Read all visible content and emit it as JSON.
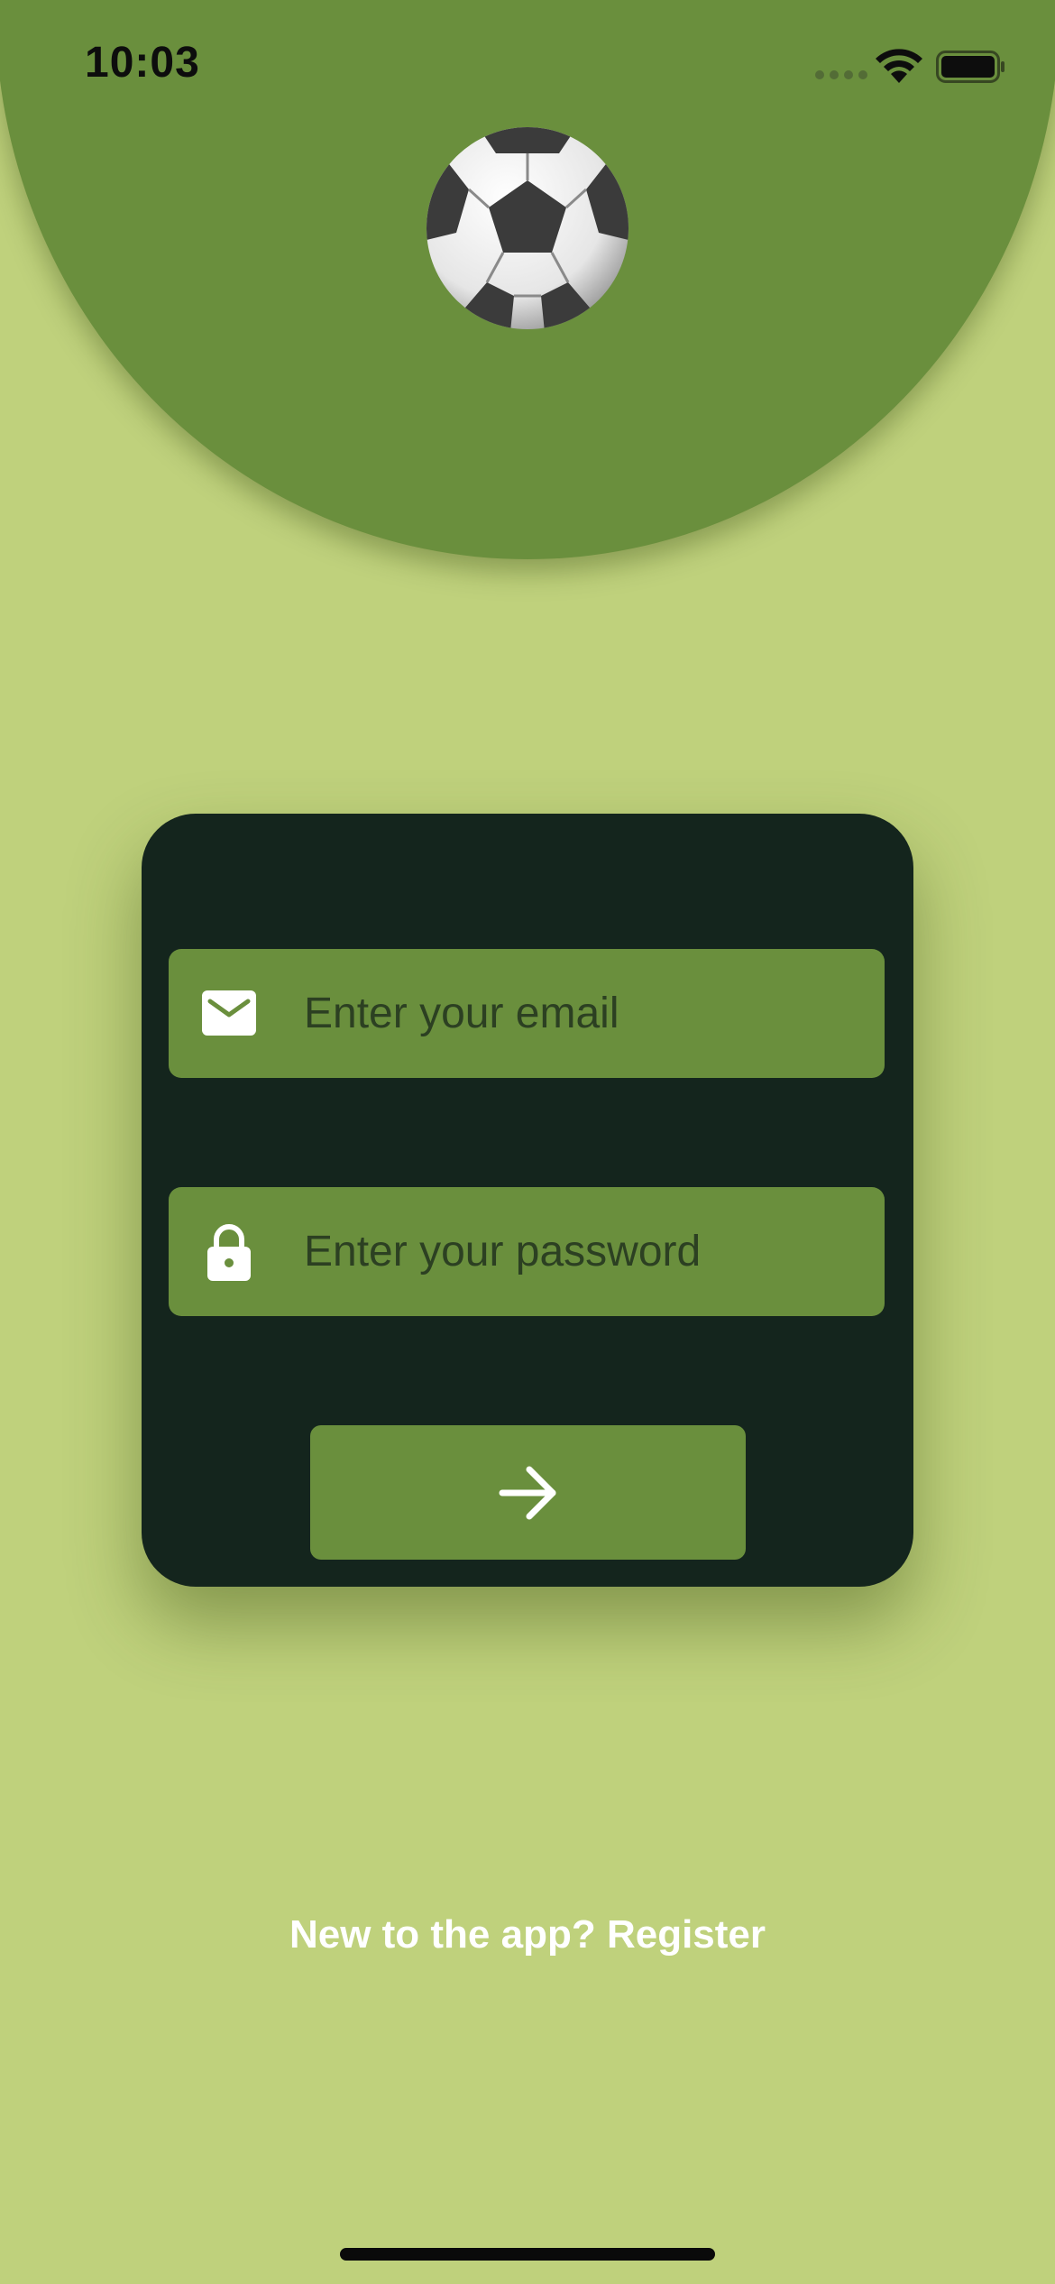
{
  "status_bar": {
    "time": "10:03"
  },
  "header": {
    "logo_icon": "soccer-ball-icon"
  },
  "login_form": {
    "email": {
      "icon": "envelope-icon",
      "value": "",
      "placeholder": "Enter your email"
    },
    "password": {
      "icon": "lock-icon",
      "value": "",
      "placeholder": "Enter your password"
    },
    "submit": {
      "icon": "arrow-right-icon"
    }
  },
  "footer": {
    "register_label": "New to the app? Register"
  },
  "colors": {
    "background": "#bfd17c",
    "accent": "#6a8f3d",
    "card": "#14251d",
    "text_light": "#ffffff"
  }
}
